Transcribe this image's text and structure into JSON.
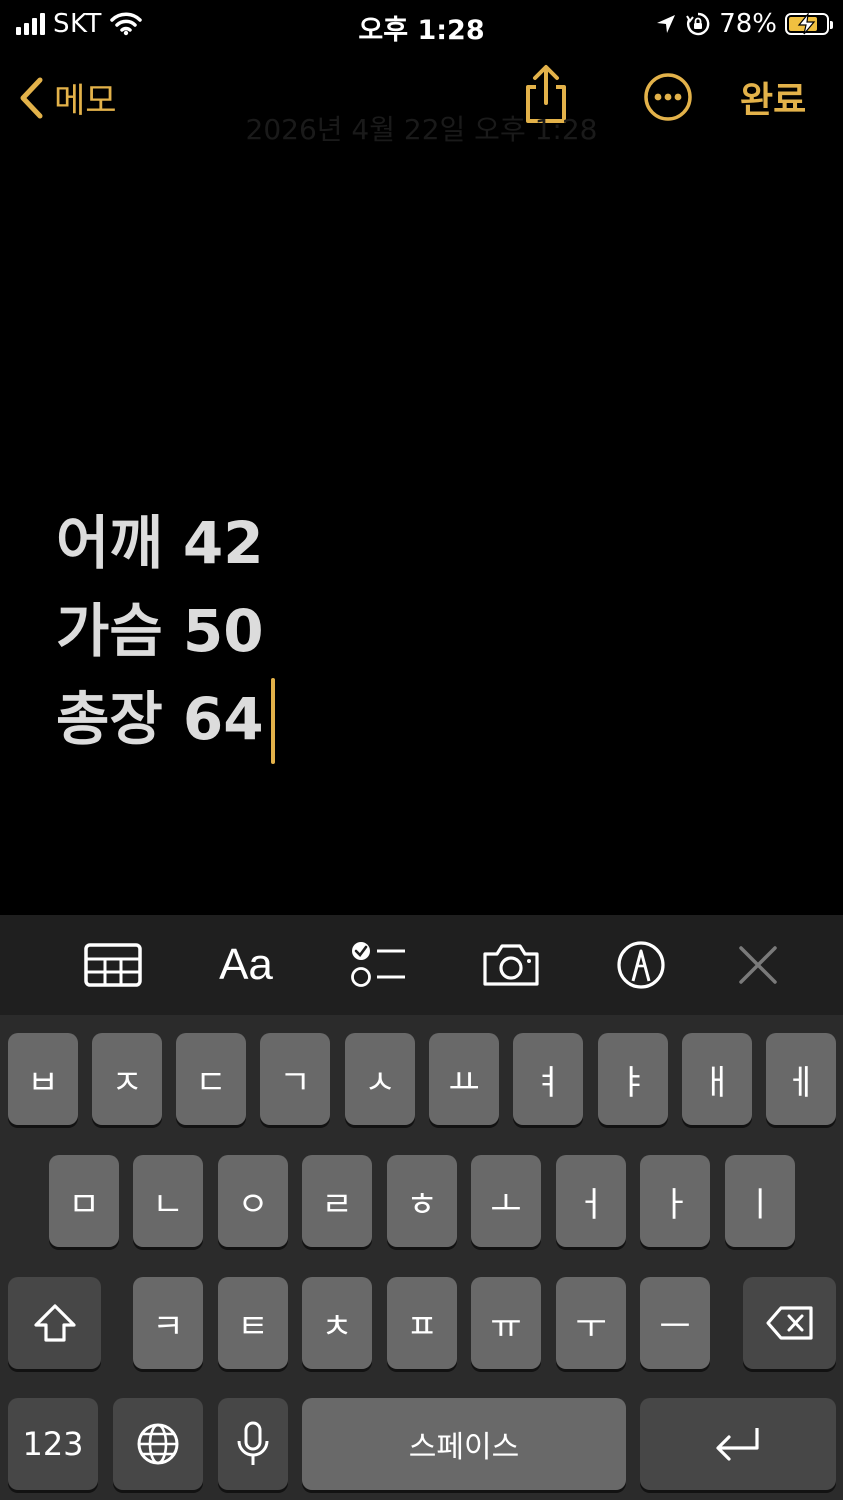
{
  "status_bar": {
    "carrier": "SKT",
    "time": "오후 1:28",
    "battery": "78%",
    "battery_level": 0.78
  },
  "nav": {
    "back_label": "메모",
    "done_label": "완료",
    "date_text": "2026년 4월 22일 오후 1:28"
  },
  "note": {
    "lines": [
      "어깨 42",
      "가슴 50",
      "총장 64"
    ]
  },
  "toolbar": {
    "format_label": "Aa"
  },
  "keyboard": {
    "row1": [
      "ㅂ",
      "ㅈ",
      "ㄷ",
      "ㄱ",
      "ㅅ",
      "ㅛ",
      "ㅕ",
      "ㅑ",
      "ㅐ",
      "ㅔ"
    ],
    "row2": [
      "ㅁ",
      "ㄴ",
      "ㅇ",
      "ㄹ",
      "ㅎ",
      "ㅗ",
      "ㅓ",
      "ㅏ",
      "ㅣ"
    ],
    "row3": [
      "ㅋ",
      "ㅌ",
      "ㅊ",
      "ㅍ",
      "ㅠ",
      "ㅜ",
      "ㅡ"
    ],
    "numbers_label": "123",
    "space_label": "스페이스"
  },
  "colors": {
    "accent": "#e3b24a",
    "background": "#000000",
    "key": "#696969",
    "key_dark": "#474747",
    "keyboard_bg": "#2b2b2b"
  }
}
